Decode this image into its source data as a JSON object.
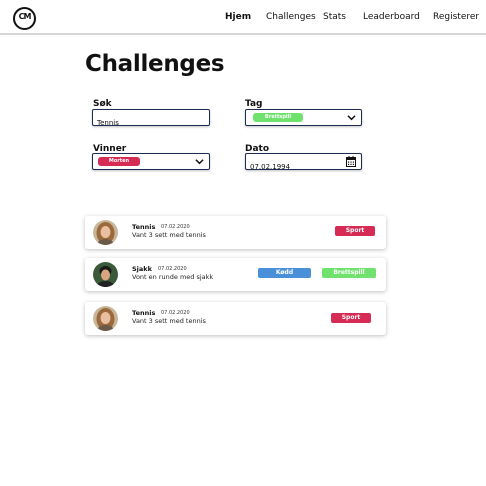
{
  "logo": {
    "text": "CM"
  },
  "nav": {
    "items": [
      {
        "label": "Hjem",
        "active": true
      },
      {
        "label": "Challenges",
        "active": false
      },
      {
        "label": "Stats",
        "active": false
      },
      {
        "label": "Leaderboard",
        "active": false
      },
      {
        "label": "Registerer",
        "active": false
      }
    ]
  },
  "page": {
    "title": "Challenges"
  },
  "filters": {
    "search": {
      "label": "Søk",
      "value": "Tennis"
    },
    "tag": {
      "label": "Tag",
      "selected": "Brettspill",
      "color": "#6ee26c"
    },
    "winner": {
      "label": "Vinner",
      "selected": "Morten",
      "color": "#d62b54"
    },
    "date": {
      "label": "Dato",
      "value": "07.02.1994"
    }
  },
  "colors": {
    "sport": "#d62b54",
    "brettspill": "#6ee26c",
    "kodd": "#4a90d9",
    "border": "#1f2d55"
  },
  "challenges": [
    {
      "title": "Tennis",
      "date": "07.02.2020",
      "description": "Vant 3 sett med tennis",
      "avatar": "avatar-woman-icon",
      "tags": [
        "Sport"
      ]
    },
    {
      "title": "Sjakk",
      "date": "07.02.2020",
      "description": "Vont en runde med sjakk",
      "avatar": "avatar-man-icon",
      "tags": [
        "Kødd",
        "Brettspill"
      ]
    },
    {
      "title": "Tennis",
      "date": "07.02.2020",
      "description": "Vant 3 sett med tennis",
      "avatar": "avatar-woman-icon",
      "tags": [
        "Sport"
      ]
    }
  ]
}
